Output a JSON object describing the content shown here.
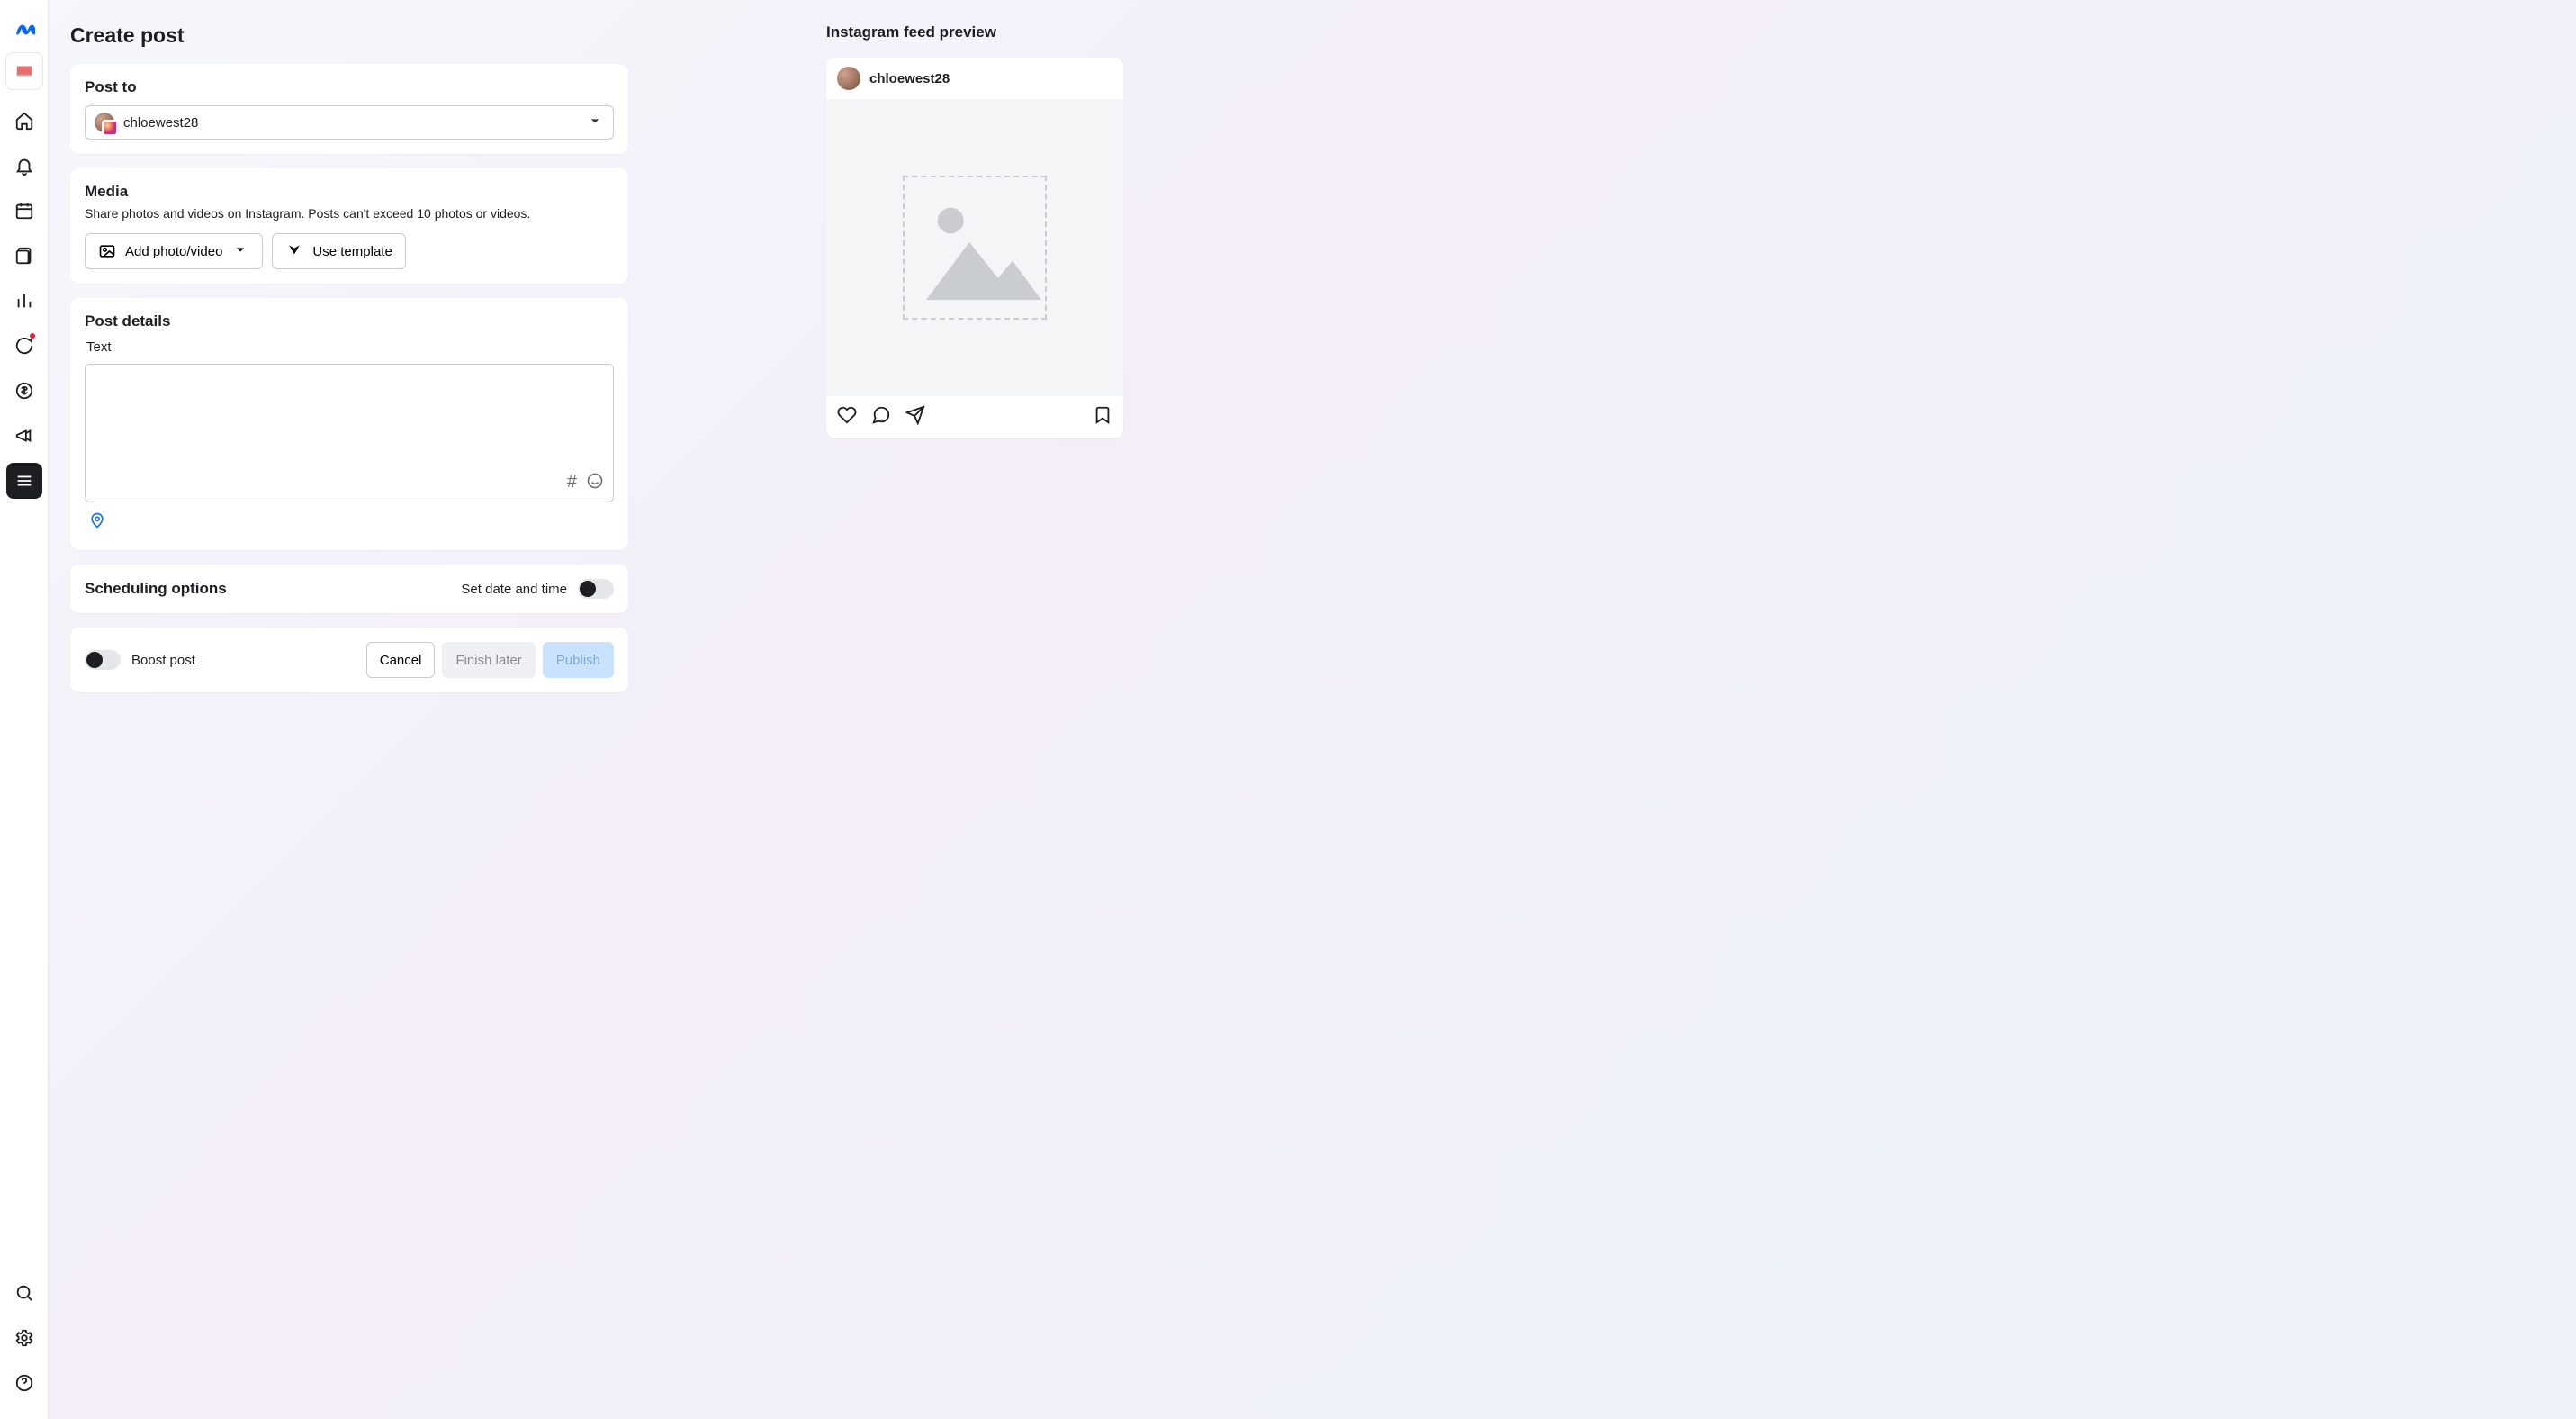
{
  "page": {
    "title": "Create post"
  },
  "sidebar": {
    "logo_name": "meta-logo",
    "tile_name": "workspace-tile",
    "items": [
      {
        "name": "sidebar-item-home",
        "icon": "home-icon"
      },
      {
        "name": "sidebar-item-notifications",
        "icon": "bell-icon",
        "has_dot": false
      },
      {
        "name": "sidebar-item-planner",
        "icon": "calendar-icon"
      },
      {
        "name": "sidebar-item-content",
        "icon": "content-icon"
      },
      {
        "name": "sidebar-item-insights",
        "icon": "insights-icon"
      },
      {
        "name": "sidebar-item-inbox",
        "icon": "chat-icon",
        "has_dot": true
      },
      {
        "name": "sidebar-item-monetization",
        "icon": "dollar-icon"
      },
      {
        "name": "sidebar-item-ads",
        "icon": "megaphone-icon"
      },
      {
        "name": "sidebar-item-all-tools",
        "icon": "menu-icon",
        "active": true
      }
    ],
    "bottom": [
      {
        "name": "sidebar-item-search",
        "icon": "search-icon"
      },
      {
        "name": "sidebar-item-settings",
        "icon": "gear-icon"
      },
      {
        "name": "sidebar-item-help",
        "icon": "help-icon"
      }
    ]
  },
  "post_to": {
    "heading": "Post to",
    "account": "chloewest28"
  },
  "media": {
    "heading": "Media",
    "subtext": "Share photos and videos on Instagram. Posts can't exceed 10 photos or videos.",
    "add_label": "Add photo/video",
    "template_label": "Use template"
  },
  "details": {
    "heading": "Post details",
    "text_label": "Text",
    "text_value": "",
    "hashtag_tool": "#",
    "emoji_tool": "emoji"
  },
  "scheduling": {
    "heading": "Scheduling options",
    "set_label": "Set date and time",
    "enabled": false
  },
  "footer": {
    "boost_label": "Boost post",
    "boost_on": false,
    "cancel": "Cancel",
    "finish_later": "Finish later",
    "publish": "Publish"
  },
  "preview": {
    "heading": "Instagram feed preview",
    "username": "chloewest28"
  }
}
